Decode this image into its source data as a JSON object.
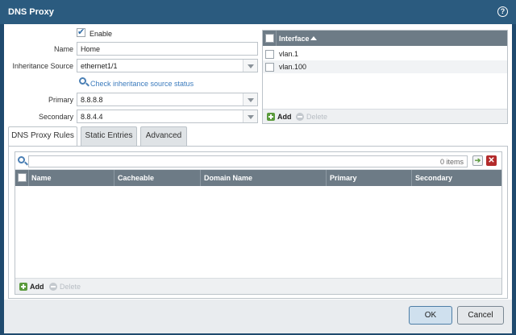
{
  "dialog": {
    "title": "DNS Proxy"
  },
  "form": {
    "enable_label": "Enable",
    "enable_checked": true,
    "name_label": "Name",
    "name_value": "Home",
    "inheritance_label": "Inheritance Source",
    "inheritance_value": "ethernet1/1",
    "check_link": "Check inheritance source status",
    "primary_label": "Primary",
    "primary_value": "8.8.8.8",
    "secondary_label": "Secondary",
    "secondary_value": "8.8.4.4"
  },
  "interfaces": {
    "header": "Interface",
    "rows": [
      "vlan.1",
      "vlan.100"
    ],
    "add_label": "Add",
    "delete_label": "Delete"
  },
  "tabs": [
    {
      "label": "DNS Proxy Rules",
      "active": true
    },
    {
      "label": "Static Entries",
      "active": false
    },
    {
      "label": "Advanced",
      "active": false
    }
  ],
  "rules_grid": {
    "items_count": "0 items",
    "columns": [
      "Name",
      "Cacheable",
      "Domain Name",
      "Primary",
      "Secondary"
    ],
    "add_label": "Add",
    "delete_label": "Delete"
  },
  "footer": {
    "ok_label": "OK",
    "cancel_label": "Cancel"
  },
  "colors": {
    "titlebar": "#2b5b7f",
    "grid_header": "#6d7b86",
    "link": "#3b7bbd"
  }
}
